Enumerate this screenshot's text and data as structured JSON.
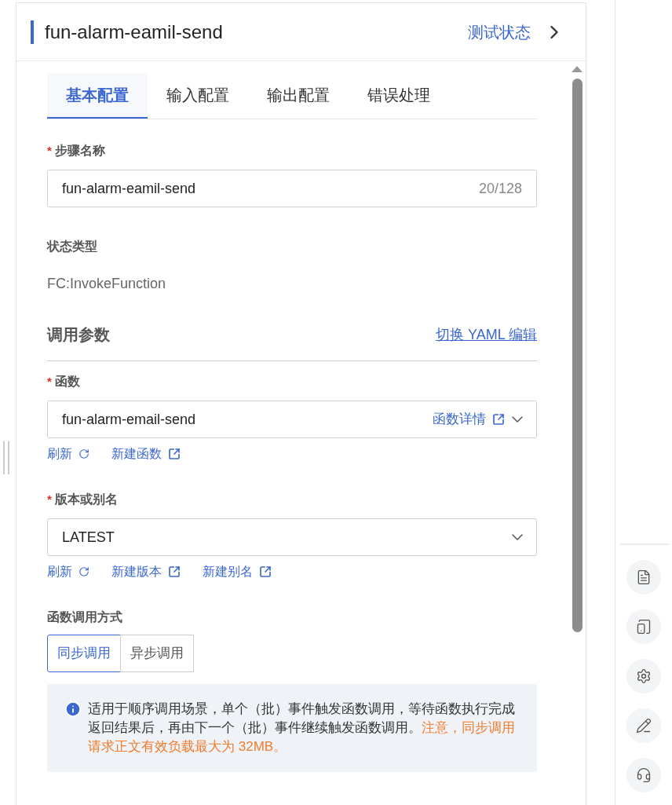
{
  "header": {
    "title": "fun-alarm-eamil-send",
    "action": "测试状态"
  },
  "tabs": [
    {
      "label": "基本配置",
      "selected": true
    },
    {
      "label": "输入配置",
      "selected": false
    },
    {
      "label": "输出配置",
      "selected": false
    },
    {
      "label": "错误处理",
      "selected": false
    }
  ],
  "step_name": {
    "label": "步骤名称",
    "required_mark": "*",
    "value": "fun-alarm-eamil-send",
    "count": "20/128"
  },
  "state_type": {
    "label": "状态类型",
    "value": "FC:InvokeFunction"
  },
  "invoke_params": {
    "title": "调用参数",
    "link": "切换 YAML 编辑"
  },
  "function": {
    "label": "函数",
    "required_mark": "*",
    "value": "fun-alarm-email-send",
    "detail_link": "函数详情",
    "links": [
      {
        "label": "刷新",
        "kind": "refresh"
      },
      {
        "label": "新建函数",
        "kind": "external"
      }
    ]
  },
  "version": {
    "label": "版本或别名",
    "required_mark": "*",
    "value": "LATEST",
    "links": [
      {
        "label": "刷新",
        "kind": "refresh"
      },
      {
        "label": "新建版本",
        "kind": "external"
      },
      {
        "label": "新建别名",
        "kind": "external"
      }
    ]
  },
  "invoke_mode": {
    "label": "函数调用方式",
    "options": [
      {
        "label": "同步调用",
        "selected": true
      },
      {
        "label": "异步调用",
        "selected": false
      }
    ]
  },
  "notice": {
    "text": "适用于顺序调用场景，单个（批）事件触发函数调用，等待函数执行完成返回结果后，再由下一个（批）事件继续触发函数调用。",
    "warning": "注意，同步调用请求正文有效负载最大为 32MB。"
  },
  "side_tools": [
    {
      "kind": "document"
    },
    {
      "kind": "app"
    },
    {
      "kind": "settings"
    },
    {
      "kind": "edit"
    },
    {
      "kind": "support"
    }
  ]
}
